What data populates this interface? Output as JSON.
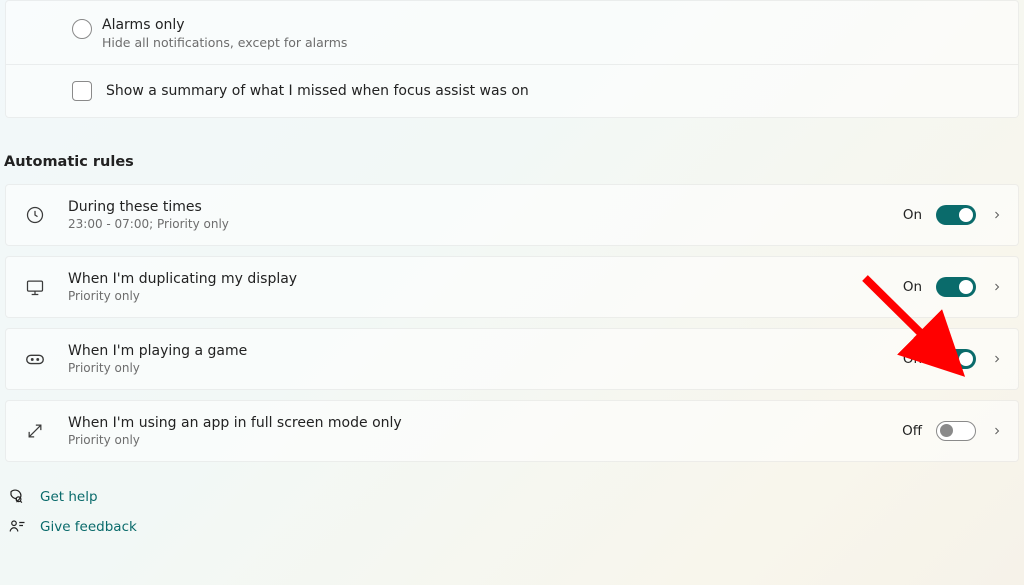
{
  "options": {
    "alarms_only": {
      "title": "Alarms only",
      "sub": "Hide all notifications, except for alarms"
    },
    "summary_label": "Show a summary of what I missed when focus assist was on"
  },
  "section_title": "Automatic rules",
  "rules": [
    {
      "title": "During these times",
      "sub": "23:00 - 07:00; Priority only",
      "state": "On",
      "on": true
    },
    {
      "title": "When I'm duplicating my display",
      "sub": "Priority only",
      "state": "On",
      "on": true
    },
    {
      "title": "When I'm playing a game",
      "sub": "Priority only",
      "state": "On",
      "on": true
    },
    {
      "title": "When I'm using an app in full screen mode only",
      "sub": "Priority only",
      "state": "Off",
      "on": false
    }
  ],
  "links": {
    "help": "Get help",
    "feedback": "Give feedback"
  },
  "annotation": {
    "arrow_target": "rule-game-toggle"
  }
}
